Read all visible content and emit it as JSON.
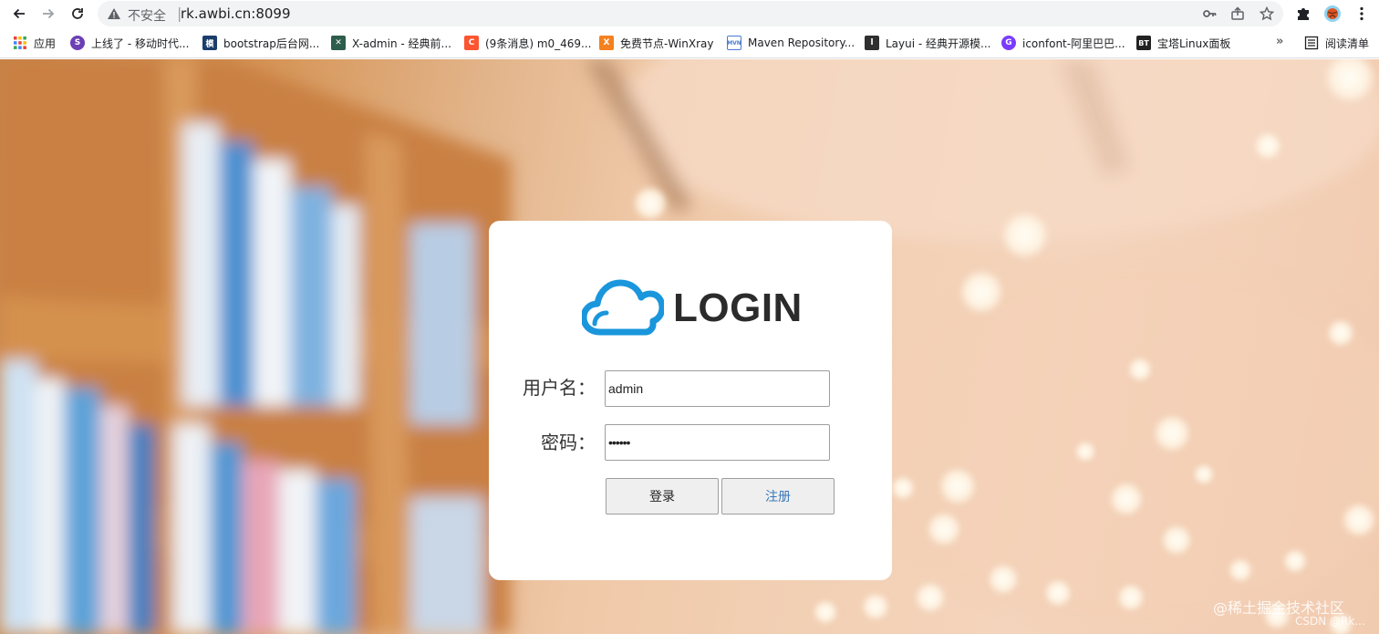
{
  "browser": {
    "omnibox": {
      "security_label": "不安全",
      "separator": "|",
      "url": "rk.awbi.cn:8099"
    },
    "icons": [
      "back-arrow-icon",
      "forward-arrow-icon",
      "reload-icon",
      "warning-triangle-icon",
      "key-icon",
      "share-icon",
      "star-icon",
      "puzzle-extension-icon",
      "profile-avatar-icon",
      "more-vert-icon"
    ]
  },
  "bookmarks": {
    "items": [
      {
        "label": "应用",
        "icon": "apps-grid-icon"
      },
      {
        "label": "上线了 - 移动时代...",
        "icon": "purple-s-icon",
        "color": "#6c3fb5"
      },
      {
        "label": "bootstrap后台网...",
        "icon": "blue-mo-icon",
        "color": "#1a73e8"
      },
      {
        "label": "X-admin - 经典前...",
        "icon": "x-admin-icon",
        "color": "#2e5d4b"
      },
      {
        "label": "(9条消息) m0_469...",
        "icon": "csdn-c-icon",
        "color": "#fc5531"
      },
      {
        "label": "免费节点-WinXray",
        "icon": "orange-x-icon",
        "color": "#f4811f"
      },
      {
        "label": "Maven Repository...",
        "icon": "mvn-icon",
        "color": "#4b7bd0"
      },
      {
        "label": "Layui - 经典开源模...",
        "icon": "layui-icon",
        "color": "#2f2f2f"
      },
      {
        "label": "iconfont-阿里巴巴...",
        "icon": "iconfont-icon",
        "color": "#7a3cff"
      },
      {
        "label": "宝塔Linux面板",
        "icon": "bt-icon",
        "color": "#222222"
      }
    ],
    "more": "»",
    "reading_list": "阅读清单"
  },
  "login": {
    "title": "LOGIN",
    "username_label": "用户名：",
    "username_value": "admin",
    "password_label": "密码：",
    "password_value": "••••••",
    "login_button": "登录",
    "register_button": "注册"
  },
  "watermark": {
    "line1": "@稀土掘金技术社区",
    "line2": "CSDN @Rk..."
  },
  "colors": {
    "logo_blue": "#1a96dc",
    "register_text": "#3b78b8"
  }
}
